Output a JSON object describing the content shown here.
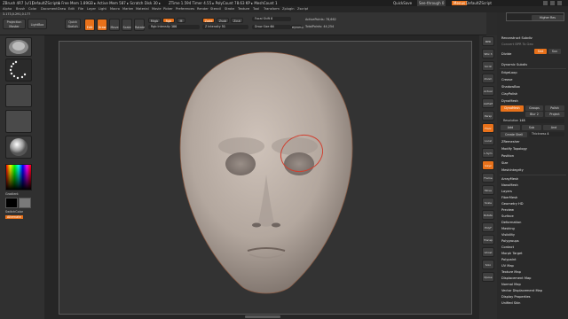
{
  "window": {
    "title_parts": [
      "ZBrush 4R7 [v/1]",
      "DefaultZScript4",
      "▸ Free Mem 1.89GB ▸ Active Mem 587 ▸ Scratch Disk 30 ▸",
      "ZTime 1.594 Timer 4.55 ▸ PolyCount 78.63 KP ▸ MeshCount 1"
    ],
    "right_items": [
      "QuickSave",
      "See-through 0",
      "Menus",
      "DefaultZScript"
    ]
  },
  "menubar": {
    "items": [
      "Alpha",
      "Brush",
      "Color",
      "Document",
      "Draw",
      "Edit",
      "File",
      "Layer",
      "Light",
      "Macro",
      "Marker",
      "Material",
      "Movie",
      "Picker",
      "Preferences",
      "Render",
      "Stencil",
      "Stroke",
      "Texture",
      "Tool",
      "Transform",
      "Zplugin",
      "Zscript"
    ]
  },
  "coords": "3.173,0.291,0.177",
  "top_shelf": {
    "projection_master": "Projection Master",
    "lightbox": "LightBox",
    "quick_sketch": "Quick Sketch",
    "edit": "Edit",
    "draw": "Draw",
    "move": "Move",
    "scale": "Scale",
    "rotate": "Rotate",
    "mrgb": "Mrgb",
    "rgb": "Rgb",
    "m": "M",
    "rgb_intensity_label": "Rgb Intensity",
    "rgb_intensity_value": "100",
    "zadd": "Zadd",
    "zsub": "Zsub",
    "zcut": "Zcut",
    "z_intensity_label": "Z Intensity",
    "z_intensity_value": "51",
    "focal_shift_label": "Focal Shift",
    "focal_shift_value": "0",
    "draw_size_label": "Draw Size",
    "draw_size_value": "64",
    "dynamic": "Dynamic",
    "active_points_label": "ActivePoints:",
    "active_points_value": "78,662",
    "total_points_label": "TotalPoints:",
    "total_points_value": "44,254"
  },
  "left_shelf": {
    "gradient": "Gradient",
    "switch_color": "SwitchColor",
    "alternate": "Alternate"
  },
  "right_shelf": {
    "icons": [
      "BPR",
      "SPix 3",
      "Scroll",
      "Zoom",
      "Actual",
      "AAHalf",
      "Persp",
      "Floor",
      "Local",
      "L.Sym",
      "Gxyz",
      "Frame",
      "Move",
      "Scale",
      "Rotate",
      "PolyF",
      "Transp",
      "Ghost",
      "Solo",
      "Xpose"
    ]
  },
  "tray": {
    "top_button": "Higher Res",
    "items_top": [
      "Reconstruct Subdiv",
      "Convert BPR To Geo",
      "Divide",
      "Smt",
      "Suv",
      "Dynamic Subdiv",
      "EdgeLoop",
      "Crease",
      "ShadowBox",
      "ClayPolish",
      "DynaMesh"
    ],
    "dynamesh_button": "DynaMesh",
    "groups": "Groups",
    "polish": "Polish",
    "blur": "Blur",
    "blur_value": "2",
    "project": "Project",
    "resolution_label": "Resolution",
    "resolution_value": "148",
    "add": "Add",
    "sub": "Sub",
    "and": "And",
    "create_shell": "Create Shell",
    "thickness_label": "Thickness",
    "thickness_value": "4",
    "items_mid": [
      "ZRemesher",
      "Modify Topology",
      "Position",
      "Size",
      "MeshIntegrity"
    ],
    "items_bottom": [
      "ArrayMesh",
      "NanoMesh",
      "Layers",
      "FiberMesh",
      "Geometry HD",
      "Preview",
      "Surface",
      "Deformation",
      "Masking",
      "Visibility",
      "Polygroups",
      "Contact",
      "Morph Target",
      "Polypaint",
      "UV Map",
      "Texture Map",
      "Displacement Map",
      "Normal Map",
      "Vector Displacement Map",
      "Display Properties",
      "Unified Skin"
    ]
  },
  "colors": {
    "accent": "#e8711a",
    "model_skin": "#b8aca3",
    "brush_circle": "#d04030"
  }
}
